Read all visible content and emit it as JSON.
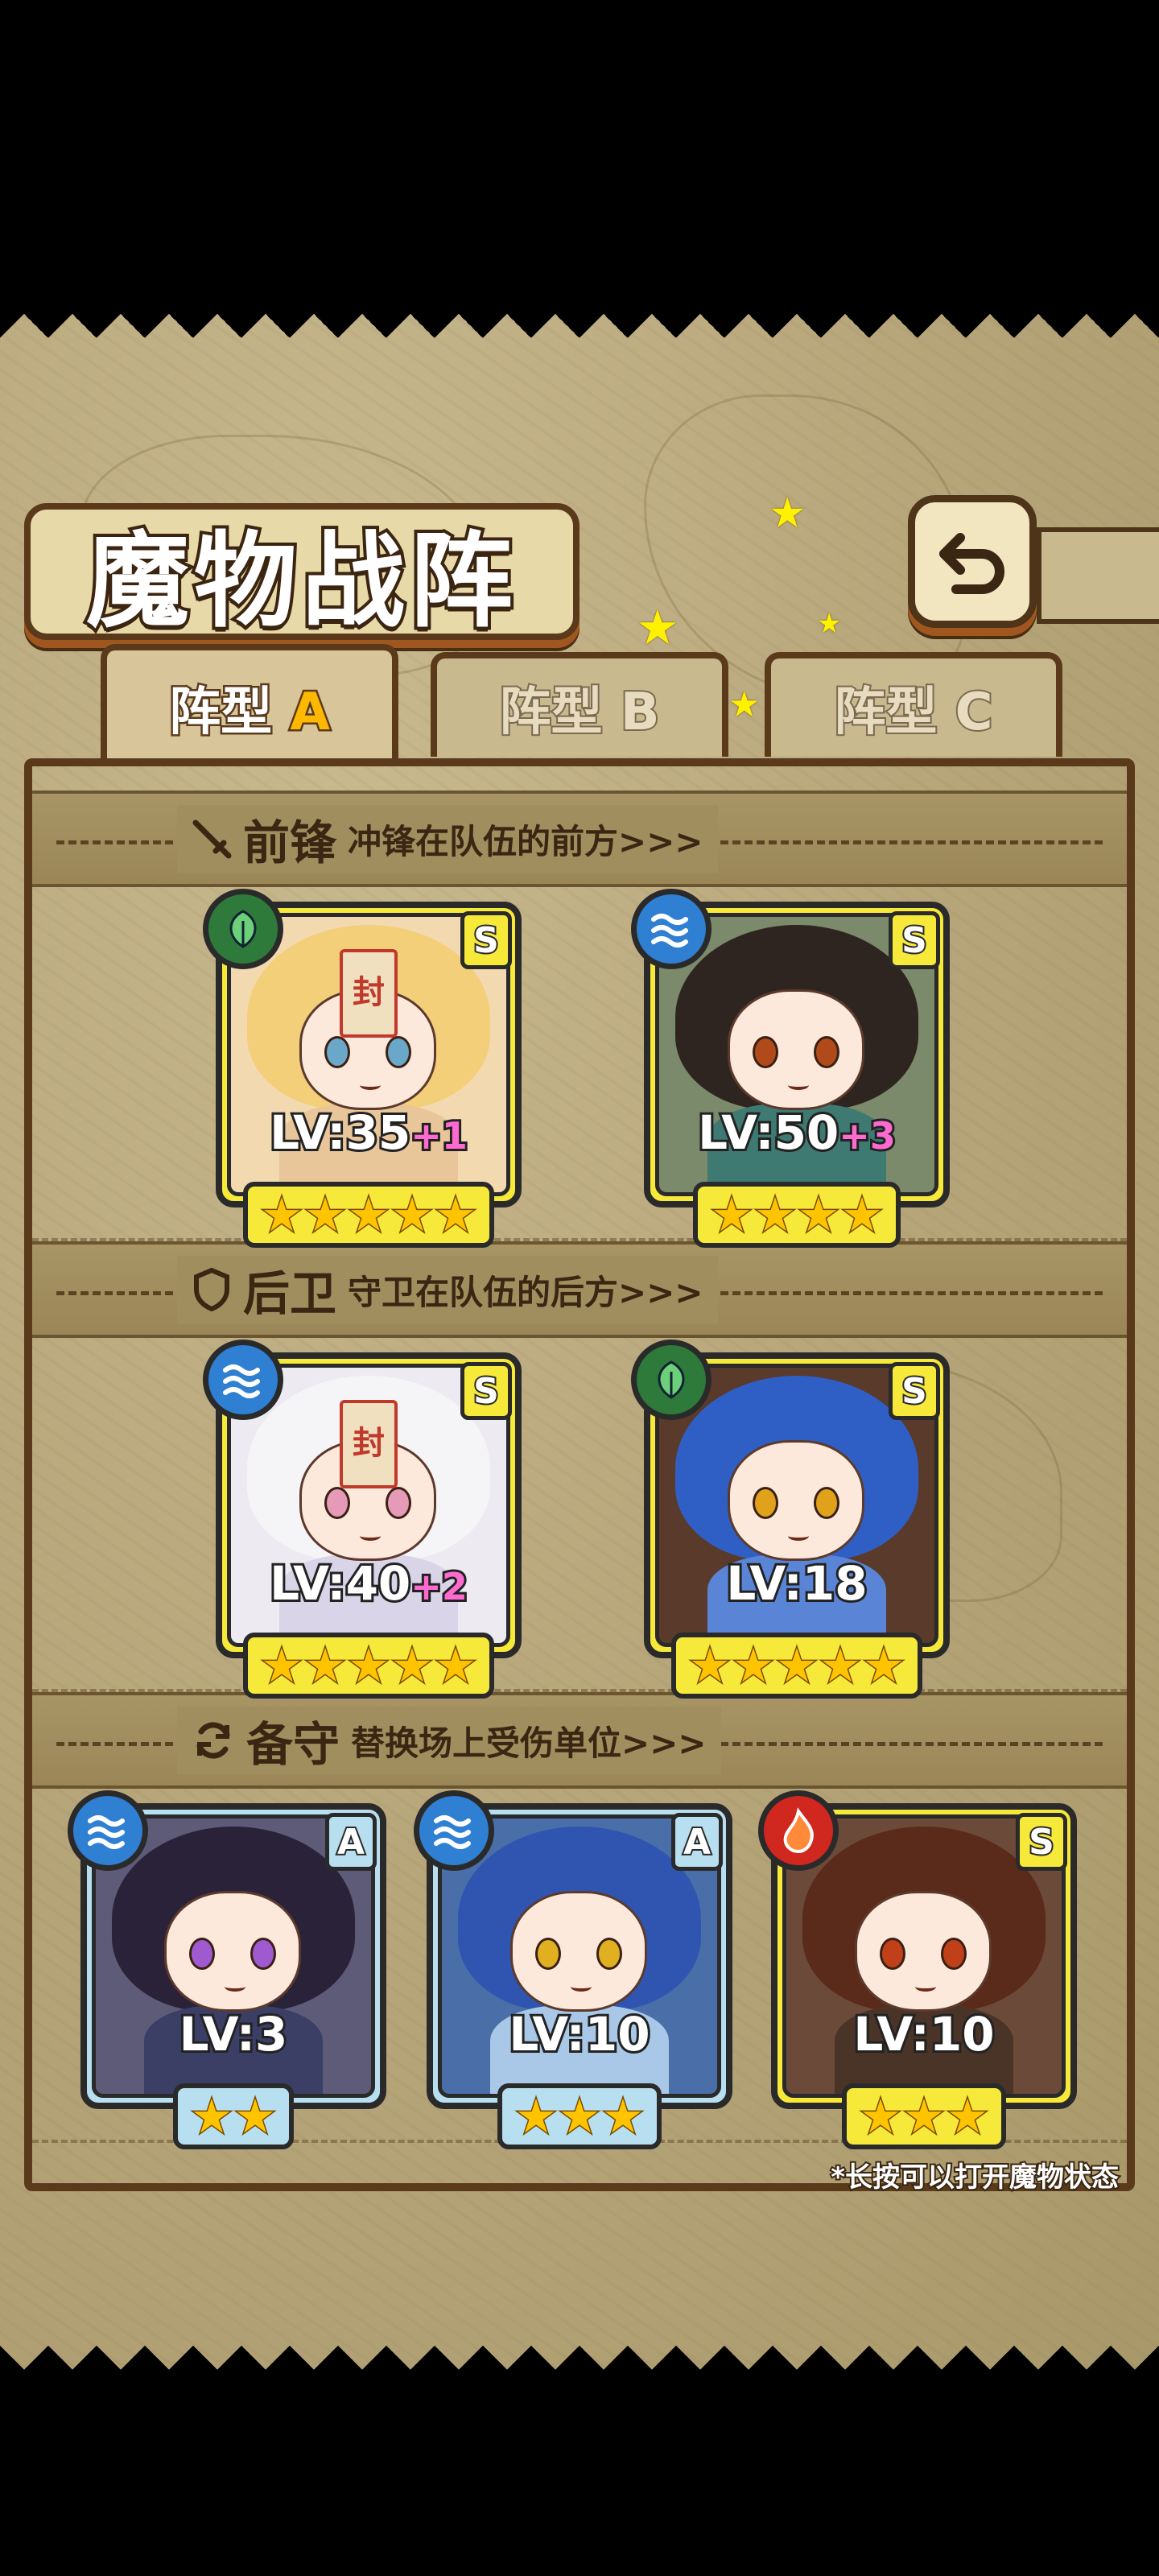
{
  "title": "魔物战阵",
  "tabs": [
    {
      "prefix": "阵型",
      "letter": "A",
      "active": true
    },
    {
      "prefix": "阵型",
      "letter": "B",
      "active": false
    },
    {
      "prefix": "阵型",
      "letter": "C",
      "active": false
    }
  ],
  "sections": {
    "front": {
      "title": "前锋",
      "subtitle": "冲锋在队伍的前方>>>",
      "icon": "sword-icon"
    },
    "back": {
      "title": "后卫",
      "subtitle": "守卫在队伍的后方>>>",
      "icon": "shield-icon"
    },
    "reserve": {
      "title": "备守",
      "subtitle": "替换场上受伤单位>>>",
      "icon": "cycle-icon"
    }
  },
  "front_cards": [
    {
      "element": "grass",
      "rank": "S",
      "level": "LV:35",
      "plus": "+1",
      "stars": 5,
      "frame": "gold",
      "sealed": true,
      "seal_text": "封"
    },
    {
      "element": "water",
      "rank": "S",
      "level": "LV:50",
      "plus": "+3",
      "stars": 4,
      "frame": "gold",
      "sealed": false
    }
  ],
  "back_cards": [
    {
      "element": "water",
      "rank": "S",
      "level": "LV:40",
      "plus": "+2",
      "stars": 5,
      "frame": "gold",
      "sealed": true,
      "seal_text": "封"
    },
    {
      "element": "grass",
      "rank": "S",
      "level": "LV:18",
      "plus": "",
      "stars": 5,
      "frame": "gold",
      "sealed": false
    }
  ],
  "reserve_cards": [
    {
      "element": "water",
      "rank": "A",
      "level": "LV:3",
      "plus": "",
      "stars": 2,
      "frame": "blue",
      "sealed": false
    },
    {
      "element": "water",
      "rank": "A",
      "level": "LV:10",
      "plus": "",
      "stars": 3,
      "frame": "blue",
      "sealed": false
    },
    {
      "element": "fire",
      "rank": "S",
      "level": "LV:10",
      "plus": "",
      "stars": 3,
      "frame": "gold",
      "sealed": false
    }
  ],
  "hint": "*长按可以打开魔物状态",
  "colors": {
    "gold_frame": "#f7e93a",
    "blue_frame": "#b8dff0",
    "grass": "#2d7a3a",
    "water": "#2f7fd3",
    "fire": "#d0271f",
    "plus": "#ff6ad0"
  }
}
